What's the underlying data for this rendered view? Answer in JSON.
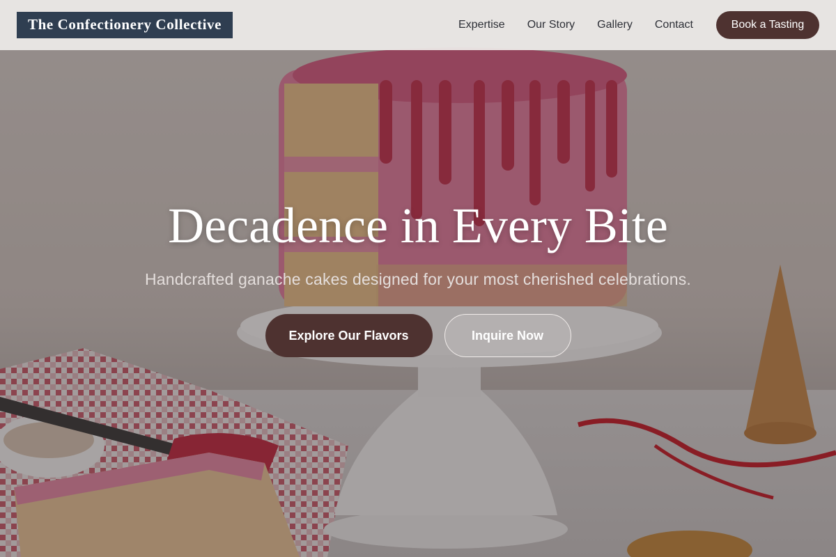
{
  "brand": {
    "name": "The Confectionery Collective"
  },
  "nav": {
    "links": [
      "Expertise",
      "Our Story",
      "Gallery",
      "Contact"
    ],
    "cta": "Book a Tasting"
  },
  "hero": {
    "title": "Decadence in Every Bite",
    "subtitle": "Handcrafted ganache cakes designed for your most cherished celebrations.",
    "primary_button": "Explore Our Flavors",
    "secondary_button": "Inquire Now"
  },
  "colors": {
    "brand_navy": "#2f3e51",
    "accent_brown": "#4e3230",
    "frosting_pink": "#d66f8c",
    "drip_red": "#c2334f"
  },
  "background": {
    "image_subject": "pink drip cake with sprinkles on a white cake stand"
  }
}
